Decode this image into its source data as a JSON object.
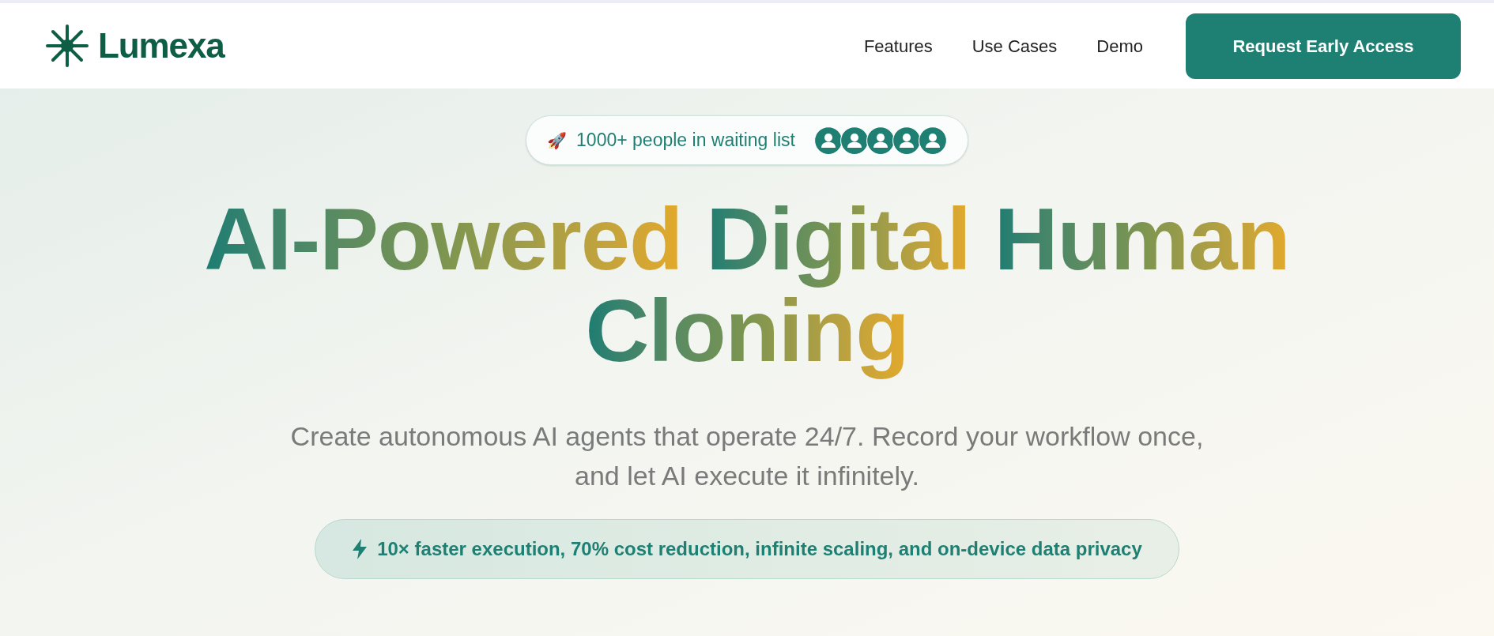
{
  "brand": {
    "name": "Lumexa"
  },
  "nav": {
    "links": [
      "Features",
      "Use Cases",
      "Demo"
    ],
    "cta": "Request Early Access"
  },
  "waitlist_badge": {
    "emoji": "🚀",
    "text": "1000+ people in waiting list",
    "avatars": [
      {
        "kind": "silhouette"
      },
      {
        "kind": "silhouette"
      },
      {
        "kind": "silhouette"
      },
      {
        "kind": "silhouette"
      },
      {
        "kind": "silhouette"
      }
    ]
  },
  "hero": {
    "title_lines": [
      [
        "AI-Powered",
        "Digital",
        "Human"
      ],
      [
        "Cloning"
      ]
    ],
    "subtitle": "Create autonomous AI agents that operate 24/7. Record your workflow once, and let AI execute it infinitely.",
    "highlight": "10× faster execution, 70% cost reduction, infinite scaling, and on-device data privacy"
  }
}
